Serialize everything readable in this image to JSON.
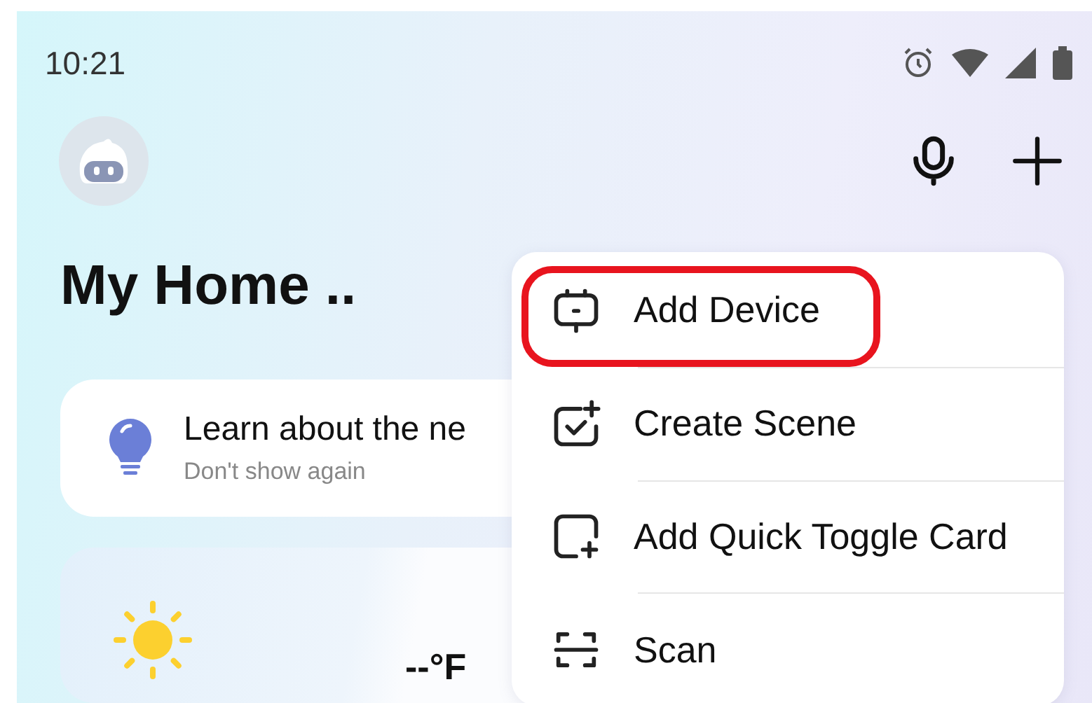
{
  "status_bar": {
    "time": "10:21"
  },
  "home": {
    "title": "My Home .."
  },
  "tip_card": {
    "title": "Learn about the ne",
    "action": "Don't show again"
  },
  "weather": {
    "temperature": "--°F"
  },
  "menu": {
    "items": [
      {
        "kind": "device",
        "label": "Add Device",
        "highlighted": true
      },
      {
        "kind": "scene",
        "label": "Create Scene",
        "highlighted": false
      },
      {
        "kind": "card",
        "label": "Add Quick Toggle Card",
        "highlighted": false
      },
      {
        "kind": "scan",
        "label": "Scan",
        "highlighted": false
      }
    ]
  }
}
